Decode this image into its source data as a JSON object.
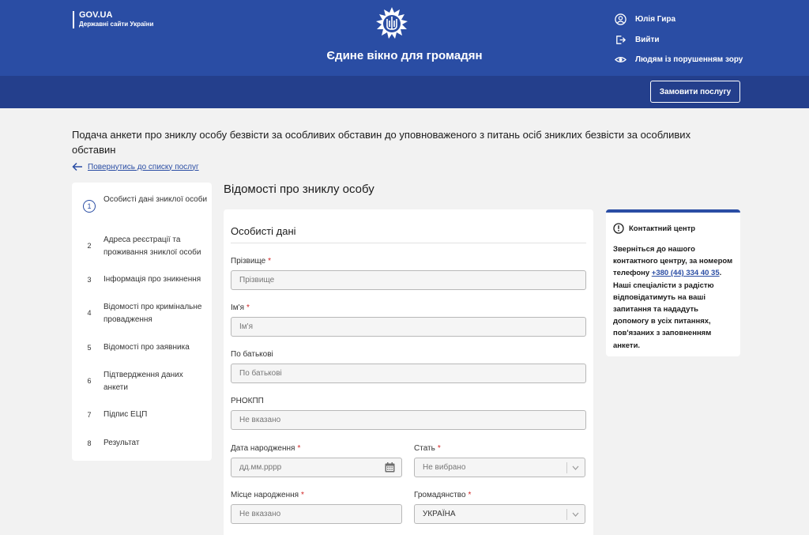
{
  "header": {
    "gov_title": "GOV.UA",
    "gov_subtitle": "Державні сайти України",
    "site_title": "Єдине вікно для громадян",
    "user_name": "Юлія Гира",
    "logout": "Вийти",
    "accessibility": "Людям із порушенням зору"
  },
  "subheader": {
    "order_button": "Замовити послугу"
  },
  "page": {
    "title": "Подача анкети про зниклу особу безвісти за особливих обставин до уповноваженого з питань осіб зниклих безвісти за особливих обставин",
    "back_link": "Повернутись до списку послуг"
  },
  "steps": [
    {
      "num": "1",
      "label": "Особисті дані зниклої особи"
    },
    {
      "num": "2",
      "label": "Адреса реєстрації та проживання зниклої особи"
    },
    {
      "num": "3",
      "label": "Інформація про зникнення"
    },
    {
      "num": "4",
      "label": "Відомості про кримінальне провадження"
    },
    {
      "num": "5",
      "label": "Відомості про заявника"
    },
    {
      "num": "6",
      "label": "Підтвердження даних анкети"
    },
    {
      "num": "7",
      "label": "Підпис ЕЦП"
    },
    {
      "num": "8",
      "label": "Результат"
    }
  ],
  "form": {
    "heading": "Відомості про зниклу особу",
    "section_title": "Особисті дані",
    "required_mark": "*",
    "fields": {
      "surname": {
        "label": "Прізвище",
        "placeholder": "Прізвище"
      },
      "name": {
        "label": "Ім'я",
        "placeholder": "Ім'я"
      },
      "patronymic": {
        "label": "По батькові",
        "placeholder": "По батькові"
      },
      "rnokpp": {
        "label": "РНОКПП",
        "placeholder": "Не вказано"
      },
      "birth_date": {
        "label": "Дата народження",
        "placeholder": "дд.мм.рррр"
      },
      "gender": {
        "label": "Стать",
        "value": "Не вибрано"
      },
      "birth_place": {
        "label": "Місце народження",
        "placeholder": "Не вказано"
      },
      "citizenship": {
        "label": "Громадянство",
        "value": "УКРАЇНА"
      }
    }
  },
  "contact": {
    "title": "Контактний центр",
    "text_before": "Зверніться до нашого контактного центру, за номером телефону ",
    "phone": "+380 (44) 334 40 35",
    "text_after": ". Наші спеціалісти з радістю відповідатимуть на ваші запитання та нададуть допомогу в усіх питаннях, пов'язаних з заповненням анкети."
  },
  "colors": {
    "primary": "#2a4da4",
    "subheader": "#243f8c",
    "required": "#d12424"
  }
}
